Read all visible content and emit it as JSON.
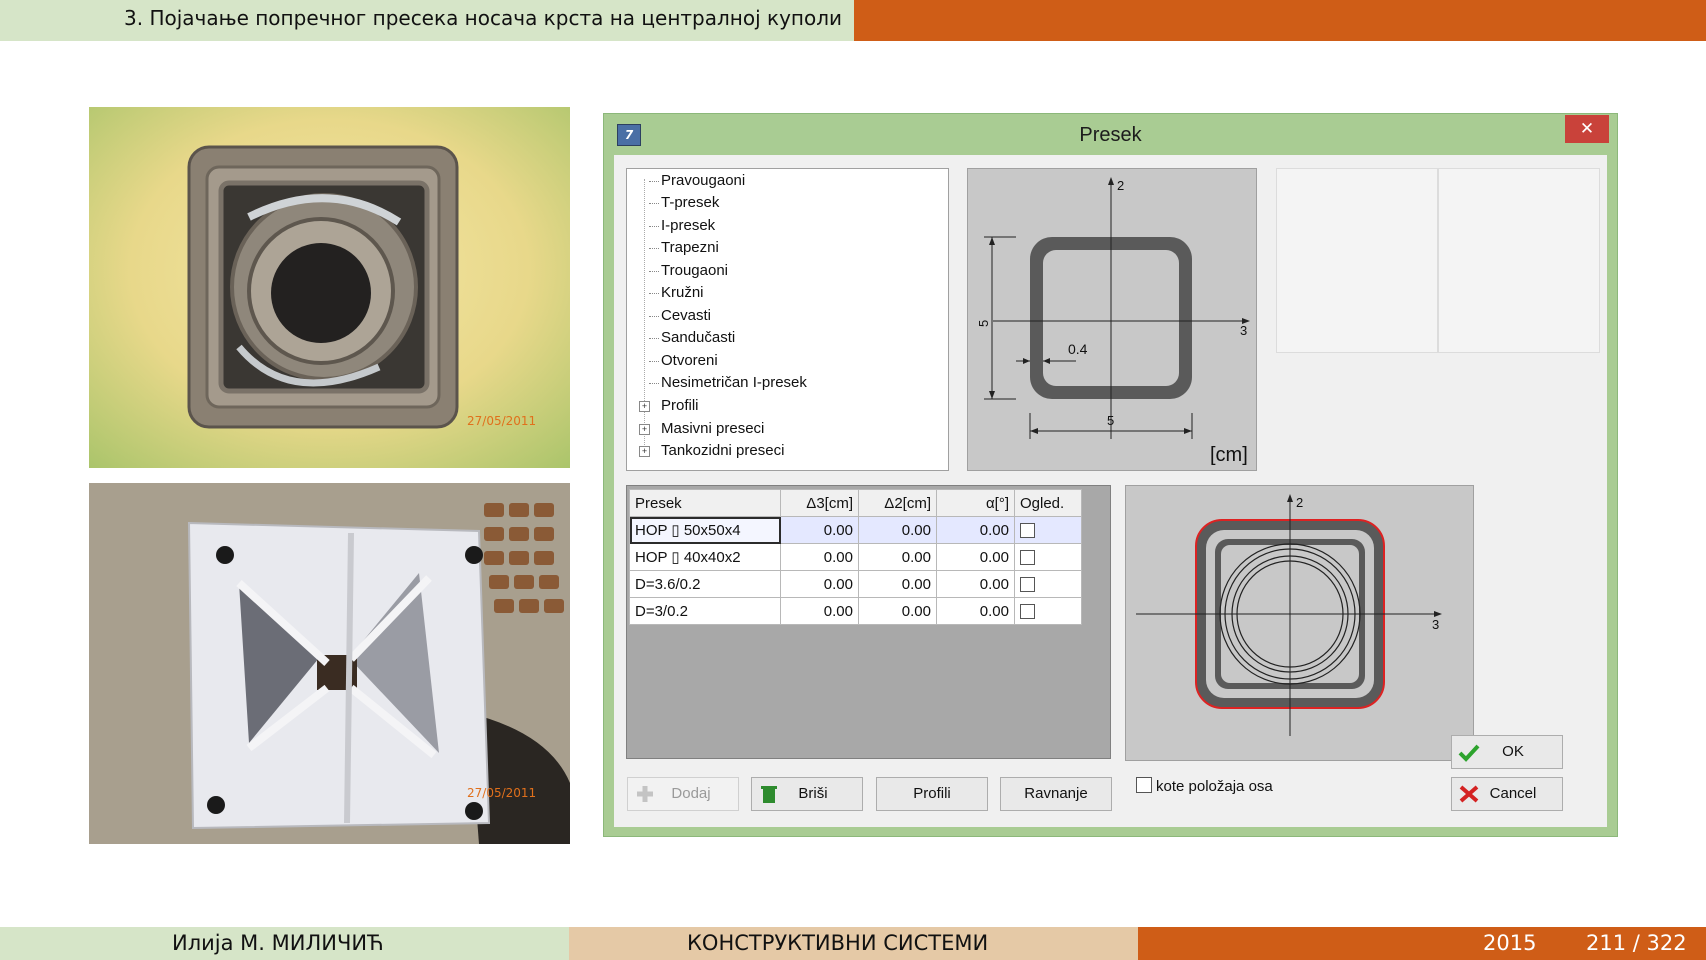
{
  "slide": {
    "title": "3. Појачање попречног пресека носача крста на централној куполи",
    "footer_author": "Илија М. МИЛИЧИЋ",
    "footer_course": "КОНСТРУКТИВНИ СИСТЕМИ",
    "footer_year": "2015",
    "footer_page": "211 / 322",
    "colors": {
      "green": "#d6e5c8",
      "tan": "#e5c9a6",
      "orange": "#cf5d17"
    }
  },
  "photos": [
    {
      "name": "welded-tubes-photo",
      "date_stamp": "27/05/2011"
    },
    {
      "name": "base-plate-photo",
      "date_stamp": "27/05/2011"
    }
  ],
  "dialog": {
    "title": "Presek",
    "close_glyph": "✕",
    "tree_items": [
      "Pravougaoni",
      "T-presek",
      "I-presek",
      "Trapezni",
      "Trougaoni",
      "Kružni",
      "Cevasti",
      "Sandučasti",
      "Otvoreni",
      "Nesimetričan I-presek"
    ],
    "tree_groups": [
      "Profili",
      "Masivni preseci",
      "Tankozidni preseci"
    ],
    "preview": {
      "axis2": "2",
      "axis3": "3",
      "dim_height": "5",
      "dim_width": "5",
      "dim_thickness": "0.4",
      "unit": "[cm]"
    },
    "table": {
      "headers": [
        "Presek",
        "Δ3[cm]",
        "Δ2[cm]",
        "α[°]",
        "Ogled."
      ],
      "rows": [
        {
          "presek": "HOP ▯ 50x50x4",
          "d3": "0.00",
          "d2": "0.00",
          "alpha": "0.00",
          "ogled": false
        },
        {
          "presek": "HOP ▯ 40x40x2",
          "d3": "0.00",
          "d2": "0.00",
          "alpha": "0.00",
          "ogled": false
        },
        {
          "presek": "D=3.6/0.2",
          "d3": "0.00",
          "d2": "0.00",
          "alpha": "0.00",
          "ogled": false
        },
        {
          "presek": "D=3/0.2",
          "d3": "0.00",
          "d2": "0.00",
          "alpha": "0.00",
          "ogled": false
        }
      ]
    },
    "composite": {
      "axis2": "2",
      "axis3": "3"
    },
    "buttons": {
      "dodaj": "Dodaj",
      "brisi": "Briši",
      "profili": "Profili",
      "ravnanje": "Ravnanje",
      "ok": "OK",
      "cancel": "Cancel"
    },
    "checkbox_label": "kote položaja osa"
  }
}
